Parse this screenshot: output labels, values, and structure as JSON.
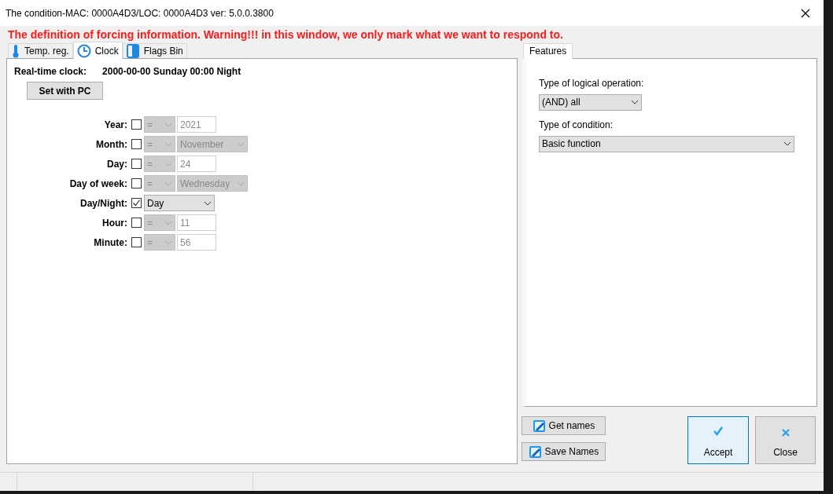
{
  "window": {
    "title": "The condition-MAC: 0000A4D3/LOC: 0000A4D3 ver: 5.0.0.3800"
  },
  "warning": "The definition of forcing information. Warning!!! in this window, we only mark what we want to respond to.",
  "tabs": [
    {
      "label": "Temp. reg.",
      "kind": "thermometer",
      "selected": false
    },
    {
      "label": "Clock",
      "kind": "clock",
      "selected": true
    },
    {
      "label": "Flags Bin",
      "kind": "flag",
      "selected": false
    }
  ],
  "clock": {
    "label": "Real-time clock:",
    "value": "2000-00-00 Sunday 00:00 Night",
    "button": "Set with PC"
  },
  "conditions": [
    {
      "label": "Year:",
      "checked": false,
      "operator": "=",
      "kind": "field",
      "value": "2021"
    },
    {
      "label": "Month:",
      "checked": false,
      "operator": "=",
      "kind": "select",
      "value": "November"
    },
    {
      "label": "Day:",
      "checked": false,
      "operator": "=",
      "kind": "field",
      "value": "24"
    },
    {
      "label": "Day of week:",
      "checked": false,
      "operator": "=",
      "kind": "select",
      "value": "Wednesday"
    },
    {
      "label": "Day/Night:",
      "checked": true,
      "kind": "select",
      "value": "Day"
    },
    {
      "label": "Hour:",
      "checked": false,
      "operator": "=",
      "kind": "field",
      "value": "11"
    },
    {
      "label": "Minute:",
      "checked": false,
      "operator": "=",
      "kind": "field",
      "value": "56"
    }
  ],
  "features": {
    "tab": "Features",
    "logical_label": "Type of logical operation:",
    "logical_value": "(AND) all",
    "condition_label": "Type of condition:",
    "condition_value": "Basic function"
  },
  "name_buttons": [
    "Get names",
    "Save Names"
  ],
  "buttons": [
    {
      "label": "Accept",
      "kind": "accept"
    },
    {
      "label": "Close",
      "kind": "close"
    }
  ]
}
